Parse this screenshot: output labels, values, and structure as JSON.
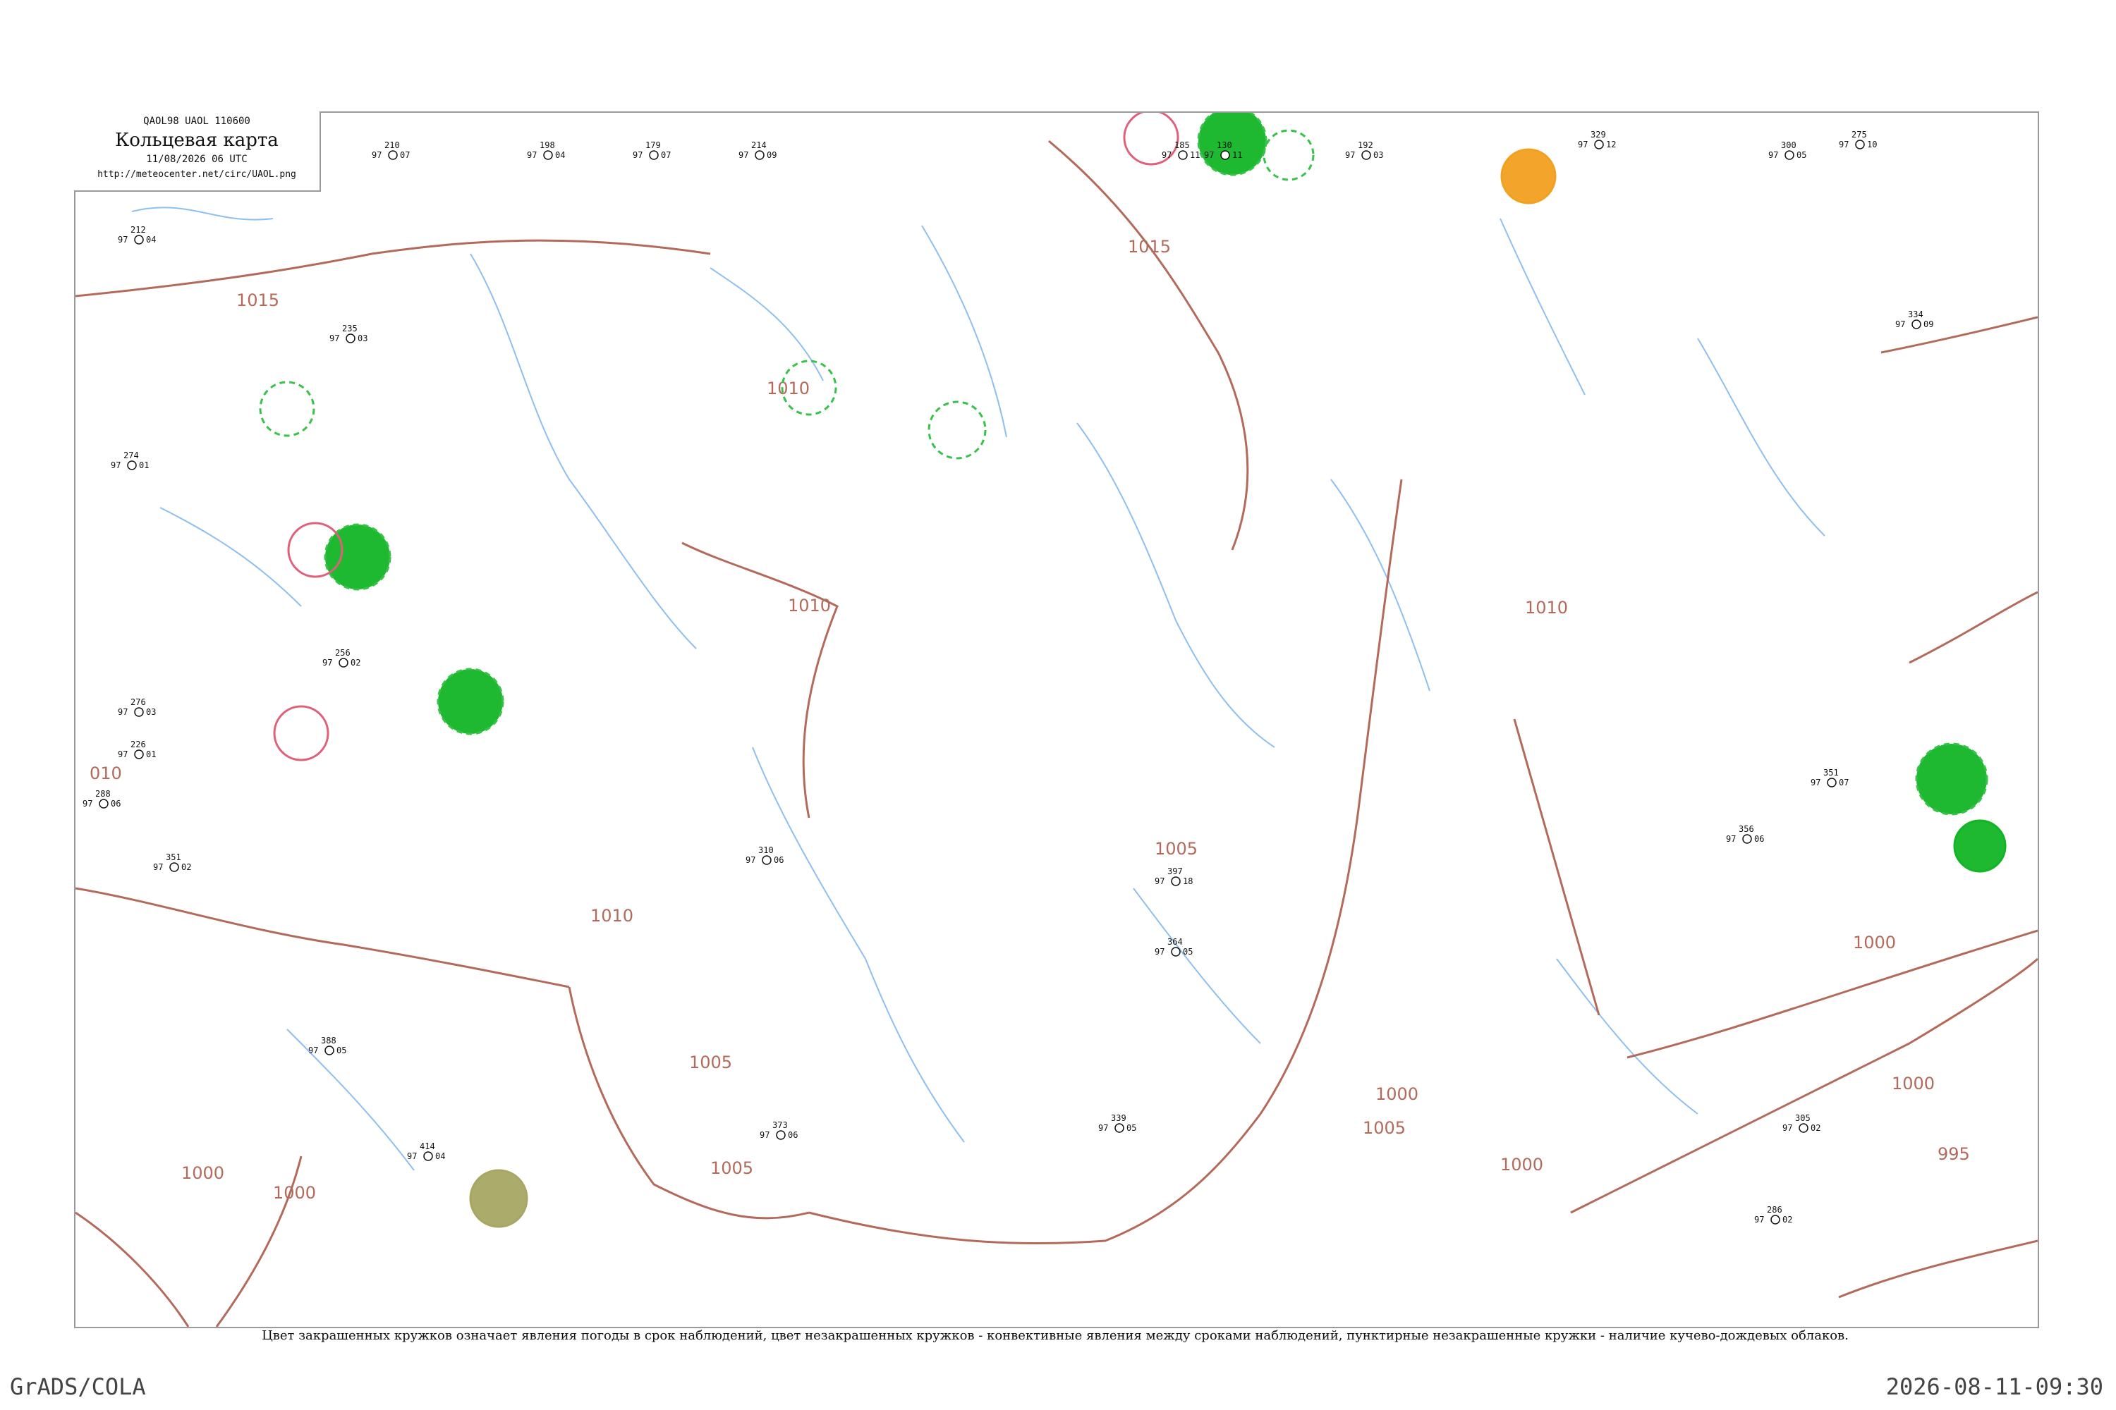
{
  "legend": {
    "codes": "QAOL98  UAOL  110600",
    "title": "Кольцевая карта",
    "time": "11/08/2026 06 UTC",
    "url": "http://meteocenter.net/circ/UAOL.png"
  },
  "caption": "Цвет закрашенных кружков означает явления погоды в срок наблюдений, цвет незакрашенных кружков - конвективные явления между сроками наблюдений, пунктирные незакрашенные кружки - наличие кучево-дождевых облаков.",
  "footer": {
    "left": "GrADS/COLA",
    "right": "2026-08-11-09:30"
  },
  "colors": {
    "isobar": "#b46a5a",
    "river": "#8fbff0",
    "cb_ring": "#39c24a",
    "convective_ring": "#e0607a",
    "weather_fill_green": "#12b526",
    "weather_fill_orange": "#f2a020",
    "weather_fill_olive": "#a7a764"
  },
  "isobar_labels": [
    "1015",
    "1015",
    "1010",
    "1010",
    "1010",
    "010",
    "1010",
    "1005",
    "1005",
    "1005",
    "1005",
    "1000",
    "1000",
    "1000",
    "1000",
    "1000",
    "995",
    "1000"
  ],
  "stations": [
    {
      "p": "210",
      "t": "97",
      "s": "07"
    },
    {
      "p": "198",
      "t": "97",
      "s": "04"
    },
    {
      "p": "179",
      "t": "97",
      "s": "07"
    },
    {
      "p": "214",
      "t": "97",
      "s": "09"
    },
    {
      "p": "185",
      "t": "97",
      "s": "11"
    },
    {
      "p": "130",
      "t": "97",
      "s": "11"
    },
    {
      "p": "192",
      "t": "97",
      "s": "03"
    },
    {
      "p": "329",
      "t": "97",
      "s": "12"
    },
    {
      "p": "275",
      "t": "97",
      "s": "10"
    },
    {
      "p": "300",
      "t": "97",
      "s": "05"
    },
    {
      "p": "212",
      "t": "97",
      "s": "04"
    },
    {
      "p": "235",
      "t": "97",
      "s": "03"
    },
    {
      "p": "274",
      "t": "97",
      "s": "01"
    },
    {
      "p": "256",
      "t": "97",
      "s": "02"
    },
    {
      "p": "276",
      "t": "97",
      "s": "03"
    },
    {
      "p": "226",
      "t": "97",
      "s": "01"
    },
    {
      "p": "288",
      "t": "97",
      "s": "06"
    },
    {
      "p": "351",
      "t": "97",
      "s": "02"
    },
    {
      "p": "388",
      "t": "97",
      "s": "05"
    },
    {
      "p": "414",
      "t": "97",
      "s": "04"
    },
    {
      "p": "310",
      "t": "97",
      "s": "06"
    },
    {
      "p": "397",
      "t": "97",
      "s": "18"
    },
    {
      "p": "364",
      "t": "97",
      "s": "05"
    },
    {
      "p": "339",
      "t": "97",
      "s": "05"
    },
    {
      "p": "373",
      "t": "97",
      "s": "06"
    },
    {
      "p": "356",
      "t": "97",
      "s": "06"
    },
    {
      "p": "286",
      "t": "97",
      "s": "02"
    },
    {
      "p": "305",
      "t": "97",
      "s": "02"
    },
    {
      "p": "334",
      "t": "97",
      "s": "09"
    },
    {
      "p": "351",
      "t": "97",
      "s": "07"
    }
  ]
}
